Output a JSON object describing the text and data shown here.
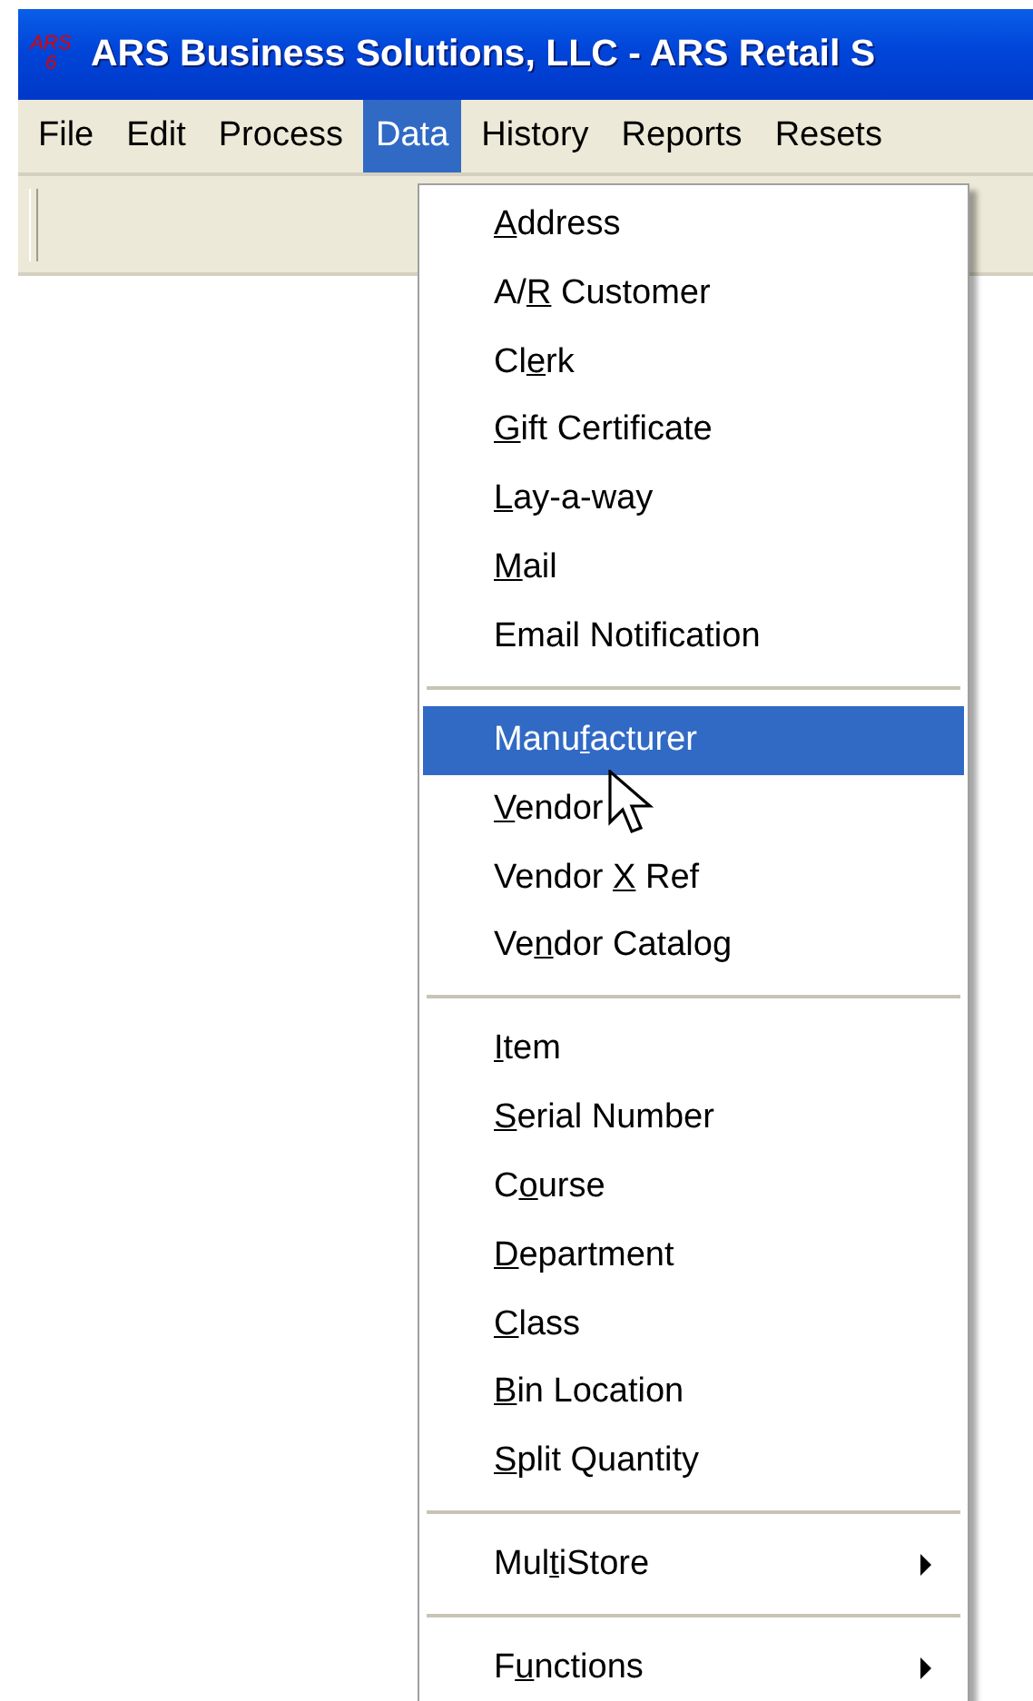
{
  "window": {
    "icon_text": [
      "ARS",
      "6"
    ],
    "title": "ARS Business Solutions, LLC - ARS Retail S"
  },
  "menu_bar": [
    {
      "label": "File",
      "selected": false
    },
    {
      "label": "Edit",
      "selected": false
    },
    {
      "label": "Process",
      "selected": false
    },
    {
      "label": "Data",
      "selected": true
    },
    {
      "label": "History",
      "selected": false
    },
    {
      "label": "Reports",
      "selected": false
    },
    {
      "label": "Resets",
      "selected": false
    }
  ],
  "data_menu": [
    {
      "kind": "item",
      "key": "A",
      "after": "ddress",
      "selected": false
    },
    {
      "kind": "item",
      "before": "A/",
      "key": "R",
      "after": " Customer",
      "selected": false
    },
    {
      "kind": "item",
      "before": "Cl",
      "key": "e",
      "after": "rk",
      "selected": false
    },
    {
      "kind": "item",
      "key": "G",
      "after": "ift Certificate",
      "selected": false
    },
    {
      "kind": "item",
      "key": "L",
      "after": "ay-a-way",
      "selected": false
    },
    {
      "kind": "item",
      "key": "M",
      "after": "ail",
      "selected": false
    },
    {
      "kind": "item",
      "before": "Email Notification",
      "selected": false
    },
    {
      "kind": "separator"
    },
    {
      "kind": "item",
      "before": "Manu",
      "key": "f",
      "after": "acturer",
      "selected": true
    },
    {
      "kind": "item",
      "key": "V",
      "after": "endor",
      "selected": false
    },
    {
      "kind": "item",
      "before": "Vendor ",
      "key": "X",
      "after": " Ref",
      "selected": false
    },
    {
      "kind": "item",
      "before": "Ve",
      "key": "n",
      "after": "dor Catalog",
      "selected": false
    },
    {
      "kind": "separator"
    },
    {
      "kind": "item",
      "key": "I",
      "after": "tem",
      "selected": false
    },
    {
      "kind": "item",
      "key": "S",
      "after": "erial Number",
      "selected": false
    },
    {
      "kind": "item",
      "before": "C",
      "key": "o",
      "after": "urse",
      "selected": false
    },
    {
      "kind": "item",
      "key": "D",
      "after": "epartment",
      "selected": false
    },
    {
      "kind": "item",
      "key": "C",
      "after": "lass",
      "selected": false
    },
    {
      "kind": "item",
      "key": "B",
      "after": "in Location",
      "selected": false
    },
    {
      "kind": "item",
      "key": "S",
      "after": "plit Quantity",
      "selected": false
    },
    {
      "kind": "separator"
    },
    {
      "kind": "submenu",
      "before": "Mul",
      "key": "t",
      "after": "iStore",
      "selected": false
    },
    {
      "kind": "separator"
    },
    {
      "kind": "submenu",
      "before": "F",
      "key": "u",
      "after": "nctions",
      "selected": false
    }
  ]
}
